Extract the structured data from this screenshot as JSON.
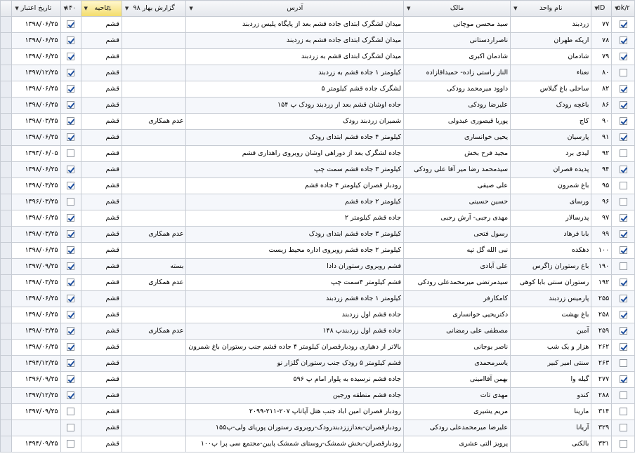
{
  "columns": {
    "date": "تاریخ اعتبار",
    "c140": "۱۴۰",
    "region": "ناحیه",
    "report": "گزارش بهار ۹۸",
    "address": "آدرس",
    "owner": "مالک",
    "unit": "نام واحد",
    "id": "ID",
    "ok": "ok/r"
  },
  "rows": [
    {
      "date": "۱۳۹۸/۰۶/۲۵",
      "c140": true,
      "region": "قشم",
      "report": "",
      "address": "میدان لشگرک ابتدای جاده قشم بعد از پایگاه پلیس زردبند",
      "owner": "سید محسن موچانی",
      "unit": "زردبند",
      "id": "۷۷",
      "ok": true
    },
    {
      "date": "۱۳۹۸/۰۶/۲۵",
      "c140": true,
      "region": "قشم",
      "report": "",
      "address": "میدان لشگرک ابتدای جاده قشم به زردبند",
      "owner": "ناصراردستانی",
      "unit": "اریکه طهران",
      "id": "۷۸",
      "ok": true
    },
    {
      "date": "۱۳۹۸/۰۶/۲۵",
      "c140": true,
      "region": "قشم",
      "report": "",
      "address": "میدان لشگرک ابتدای قشم به زردبند",
      "owner": "شادمان اکبری",
      "unit": "شادمان",
      "id": "۷۹",
      "ok": true
    },
    {
      "date": "۱۳۹۷/۱۲/۲۵",
      "c140": true,
      "region": "قشم",
      "report": "",
      "address": "کیلومتر ۱ جاده قشم به زردبند",
      "owner": "الناز راستی زاده- حمیداقازاده",
      "unit": "نعناء",
      "id": "۸۰",
      "ok": false
    },
    {
      "date": "۱۳۹۸/۰۶/۲۵",
      "c140": true,
      "region": "قشم",
      "report": "",
      "address": "لشگرک جاده قشم کیلومتر ۵",
      "owner": "داوود میرمحمد رودکی",
      "unit": "ساحلی باغ گیلاس",
      "id": "۸۲",
      "ok": true
    },
    {
      "date": "۱۳۹۸/۰۶/۲۵",
      "c140": true,
      "region": "قشم",
      "report": "",
      "address": "جاده اوشان قشم بعد از زردبند رودک پ ۱۵۴",
      "owner": "علیرضا رودکی",
      "unit": "باغچه رودک",
      "id": "۸۶",
      "ok": true
    },
    {
      "date": "۱۳۹۸/۰۳/۲۵",
      "c140": true,
      "region": "قشم",
      "report": "عدم همکاری",
      "address": "شمیران زردبند رودک",
      "owner": "پوریا قیصوری عبدولی",
      "unit": "کاج",
      "id": "۹۰",
      "ok": true
    },
    {
      "date": "۱۳۹۸/۰۶/۲۵",
      "c140": true,
      "region": "قشم",
      "report": "",
      "address": "کیلومتر ۴ جاده قشم ابتدای رودک",
      "owner": "یحیی خوانساری",
      "unit": "پارسیان",
      "id": "۹۱",
      "ok": true
    },
    {
      "date": "۱۳۹۳/۰۶/۰۵",
      "c140": false,
      "region": "قشم",
      "report": "",
      "address": "جاده لشگرک بعد از دوراهی اوشان روبروی راهداری قشم",
      "owner": "مجید فرح بخش",
      "unit": "لیدی برد",
      "id": "۹۲",
      "ok": false
    },
    {
      "date": "۱۳۹۸/۰۶/۲۵",
      "c140": true,
      "region": "قشم",
      "report": "",
      "address": "کیلومتر ۳ جاده قشم سمت چپ",
      "owner": "سیدمحمد رضا میر آقا علی رودکی",
      "unit": "پدیده قصران",
      "id": "۹۴",
      "ok": true
    },
    {
      "date": "۱۳۹۸/۰۳/۲۵",
      "c140": true,
      "region": "قشم",
      "report": "",
      "address": "رودبار قصران کیلومتر ۴ جاده قشم",
      "owner": "علی صیفی",
      "unit": "باغ شمرون",
      "id": "۹۵",
      "ok": false
    },
    {
      "date": "۱۳۹۶/۰۳/۲۵",
      "c140": false,
      "region": "قشم",
      "report": "",
      "address": "کیلومتر ۲ جاده قشم",
      "owner": "حسین حسینی",
      "unit": "ورسای",
      "id": "۹۶",
      "ok": false
    },
    {
      "date": "۱۳۹۸/۰۶/۲۵",
      "c140": true,
      "region": "قشم",
      "report": "",
      "address": "جاده قشم کیلومتر ۲",
      "owner": "مهدی رجبی- آرش رجبی",
      "unit": "پدرسالار",
      "id": "۹۷",
      "ok": true
    },
    {
      "date": "۱۳۹۸/۰۳/۲۵",
      "c140": true,
      "region": "قشم",
      "report": "عدم همکاری",
      "address": "کیلومتر ۳ جاده قشم ابتدای رودک",
      "owner": "رسول فتحی",
      "unit": "بابا فرهاد",
      "id": "۹۹",
      "ok": true
    },
    {
      "date": "۱۳۹۸/۰۶/۲۵",
      "c140": true,
      "region": "قشم",
      "report": "",
      "address": "کیلومتر ۲ جاده قشم روبروی اداره محیط زیست",
      "owner": "نبی الله گل تپه",
      "unit": "دهکده",
      "id": "۱۰۰",
      "ok": true
    },
    {
      "date": "۱۳۹۷/۰۹/۲۵",
      "c140": true,
      "region": "قشم",
      "report": "بسته",
      "address": "قشم روبروی رستوران دادا",
      "owner": "علی آبادی",
      "unit": "باغ رستوران زاگرس",
      "id": "۱۹۰",
      "ok": false
    },
    {
      "date": "۱۳۹۸/۰۳/۲۵",
      "c140": true,
      "region": "قشم",
      "report": "عدم همکاری",
      "address": "قشم کیلومتر ۴سمت چپ",
      "owner": "سیدمرتضی میرمحمدعلی رودکی",
      "unit": "رستوران سنتی بابا کوهی",
      "id": "۱۹۲",
      "ok": true
    },
    {
      "date": "۱۳۹۸/۰۶/۲۵",
      "c140": true,
      "region": "قشم",
      "report": "",
      "address": "کیلومتر ۱ جاده قشم زردبند",
      "owner": "کامکارفر",
      "unit": "پارمیس زردبند",
      "id": "۲۵۵",
      "ok": true
    },
    {
      "date": "۱۳۹۸/۰۶/۲۵",
      "c140": true,
      "region": "قشم",
      "report": "",
      "address": "جاده قشم اول زردبند",
      "owner": "دکتریحیی خوانساری",
      "unit": "باغ بهشت",
      "id": "۲۵۸",
      "ok": true
    },
    {
      "date": "۱۳۹۸/۰۳/۲۵",
      "c140": true,
      "region": "قشم",
      "report": "عدم همکاری",
      "address": "جاده قشم اول زردبندپ ۱۴۸",
      "owner": "مصطفی علی رمضانی",
      "unit": "آمین",
      "id": "۲۵۹",
      "ok": true
    },
    {
      "date": "۱۳۹۸/۰۶/۲۵",
      "c140": true,
      "region": "قشم",
      "report": "",
      "address": "بالاتر از دهیاری رودبارقصران کیلومتر ۴ جاده قشم جنب رستوران باغ شمرون",
      "owner": "ناصر یوجانی",
      "unit": "هزار و یک شب",
      "id": "۲۶۲",
      "ok": true
    },
    {
      "date": "۱۳۹۴/۱۲/۲۵",
      "c140": true,
      "region": "قشم",
      "report": "",
      "address": "قشم کیلومتر ۵ رودک جنب رستوران گلزار نو",
      "owner": "یاسرمحمدی",
      "unit": "سنتی امیر کبیر",
      "id": "۲۶۳",
      "ok": false
    },
    {
      "date": "۱۳۹۶/۰۹/۲۵",
      "c140": true,
      "region": "قشم",
      "report": "",
      "address": "جاده قشم نرسیده به پلوار امام پ ۵۹۶",
      "owner": "بهمن آقاامینی",
      "unit": "گیله وا",
      "id": "۲۷۷",
      "ok": true
    },
    {
      "date": "۱۳۹۷/۱۲/۲۵",
      "c140": true,
      "region": "قشم",
      "report": "",
      "address": "جاده قشم منطقه ورجین",
      "owner": "مهدی تات",
      "unit": "کندو",
      "id": "۲۸۸",
      "ok": false
    },
    {
      "date": "۱۳۹۷/۰۹/۲۵",
      "c140": false,
      "region": "قشم",
      "report": "",
      "address": "رودبار قصران امین اباد جنب هتل آپاتاپ ۲۰۷-۲۱۱-۲۰۹۹",
      "owner": "مریم یشیری",
      "unit": "مارینا",
      "id": "۳۱۴",
      "ok": false
    },
    {
      "date": "",
      "c140": false,
      "region": "قشم",
      "report": "",
      "address": "رودبارقصران-بعدازززدبندرودک-روبروی رستوران پوریای ولی-پ۱۵۵",
      "owner": "علیرضا میرمحمدعلی رودکی",
      "unit": "آریانا",
      "id": "۳۲۹",
      "ok": false
    },
    {
      "date": "۱۳۹۴/۰۹/۲۵",
      "c140": false,
      "region": "قشم",
      "report": "",
      "address": "رودبارقصران-بخش شمشک-روستای شمشک پایین-مجتمع سی پرا پ۱۰۰",
      "owner": "پرویز التی عشری",
      "unit": "بالکنی",
      "id": "۳۳۱",
      "ok": false
    }
  ]
}
